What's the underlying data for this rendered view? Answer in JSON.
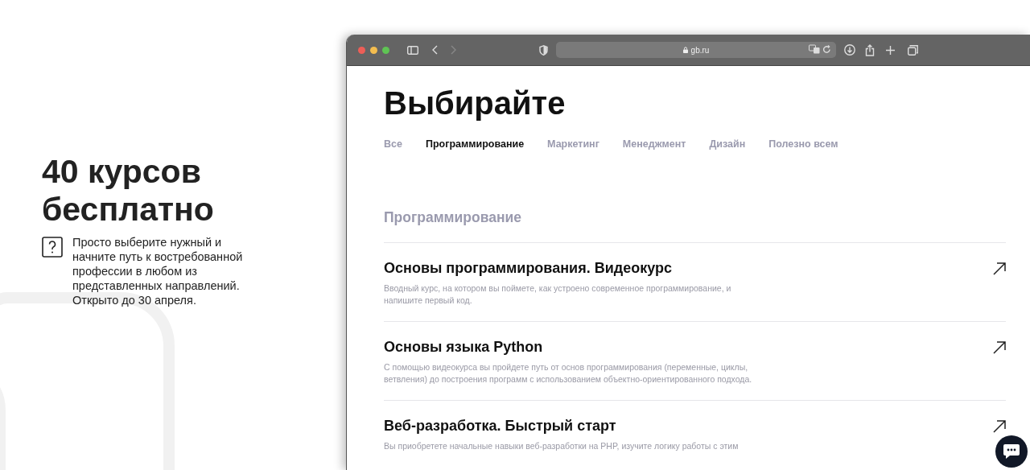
{
  "promo": {
    "headline": "40 курсов бесплатно",
    "description": "Просто выберите нужный и начните путь к востребованной профессии в любом из представленных направлений. Открыто до 30 апреля."
  },
  "browser": {
    "address": "gb.ru"
  },
  "page": {
    "title": "Выбирайте",
    "tabs": [
      {
        "label": "Все",
        "selected": false
      },
      {
        "label": "Программирование",
        "selected": true
      },
      {
        "label": "Маркетинг",
        "selected": false
      },
      {
        "label": "Менеджмент",
        "selected": false
      },
      {
        "label": "Дизайн",
        "selected": false
      },
      {
        "label": "Полезно всем",
        "selected": false
      }
    ],
    "section_title": "Программирование",
    "courses": [
      {
        "title": "Основы программирования. Видеокурс",
        "description": "Вводный курс, на котором вы поймете, как устроено современное программирование, и напишите первый код."
      },
      {
        "title": "Основы языка Python",
        "description": "С помощью видеокурса вы пройдете путь от основ программирования (переменные, циклы, ветвления) до построения программ с использованием объектно-ориентированного подхода."
      },
      {
        "title": "Веб-разработка. Быстрый старт",
        "description": "Вы приобретете начальные навыки веб-разработки на PHP, изучите логику работы с этим"
      }
    ]
  }
}
